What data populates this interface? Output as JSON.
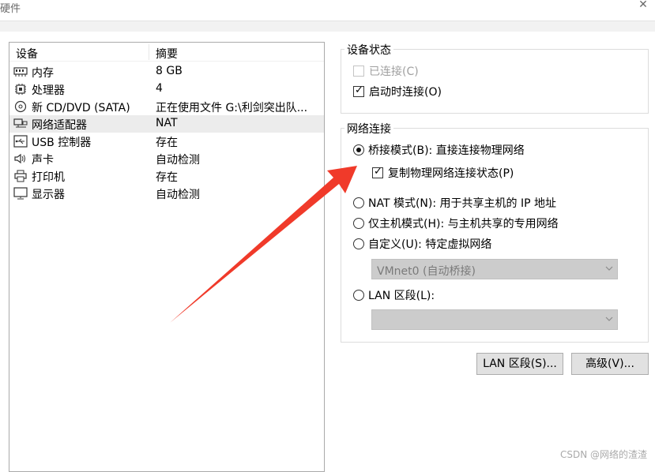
{
  "window": {
    "title": "硬件"
  },
  "devices": {
    "header": {
      "device": "设备",
      "summary": "摘要"
    },
    "items": [
      {
        "name": "内存",
        "summary": "8 GB",
        "icon": "memory-icon"
      },
      {
        "name": "处理器",
        "summary": "4",
        "icon": "cpu-icon"
      },
      {
        "name": "新 CD/DVD (SATA)",
        "summary": "正在使用文件 G:\\利剑突出队...",
        "icon": "disc-icon"
      },
      {
        "name": "网络适配器",
        "summary": "NAT",
        "icon": "network-icon",
        "selected": true
      },
      {
        "name": "USB 控制器",
        "summary": "存在",
        "icon": "usb-icon"
      },
      {
        "name": "声卡",
        "summary": "自动检测",
        "icon": "speaker-icon"
      },
      {
        "name": "打印机",
        "summary": "存在",
        "icon": "printer-icon"
      },
      {
        "name": "显示器",
        "summary": "自动检测",
        "icon": "monitor-icon"
      }
    ]
  },
  "device_status": {
    "title": "设备状态",
    "connected": {
      "label": "已连接(C)",
      "checked": false,
      "disabled": true
    },
    "connect_on_start": {
      "label": "启动时连接(O)",
      "checked": true
    }
  },
  "network": {
    "title": "网络连接",
    "bridged": {
      "label": "桥接模式(B): 直接连接物理网络",
      "selected": true
    },
    "replicate": {
      "label": "复制物理网络连接状态(P)",
      "checked": true
    },
    "nat": {
      "label": "NAT 模式(N): 用于共享主机的 IP 地址",
      "selected": false
    },
    "hostonly": {
      "label": "仅主机模式(H): 与主机共享的专用网络",
      "selected": false
    },
    "custom": {
      "label": "自定义(U): 特定虚拟网络",
      "selected": false
    },
    "custom_value": "VMnet0 (自动桥接)",
    "lan": {
      "label": "LAN 区段(L):",
      "selected": false
    },
    "lan_value": ""
  },
  "buttons": {
    "lan_segments": "LAN 区段(S)...",
    "advanced": "高级(V)..."
  },
  "watermark": "CSDN @网络的渣渣",
  "colors": {
    "annotation_arrow": "#f03a2a"
  }
}
